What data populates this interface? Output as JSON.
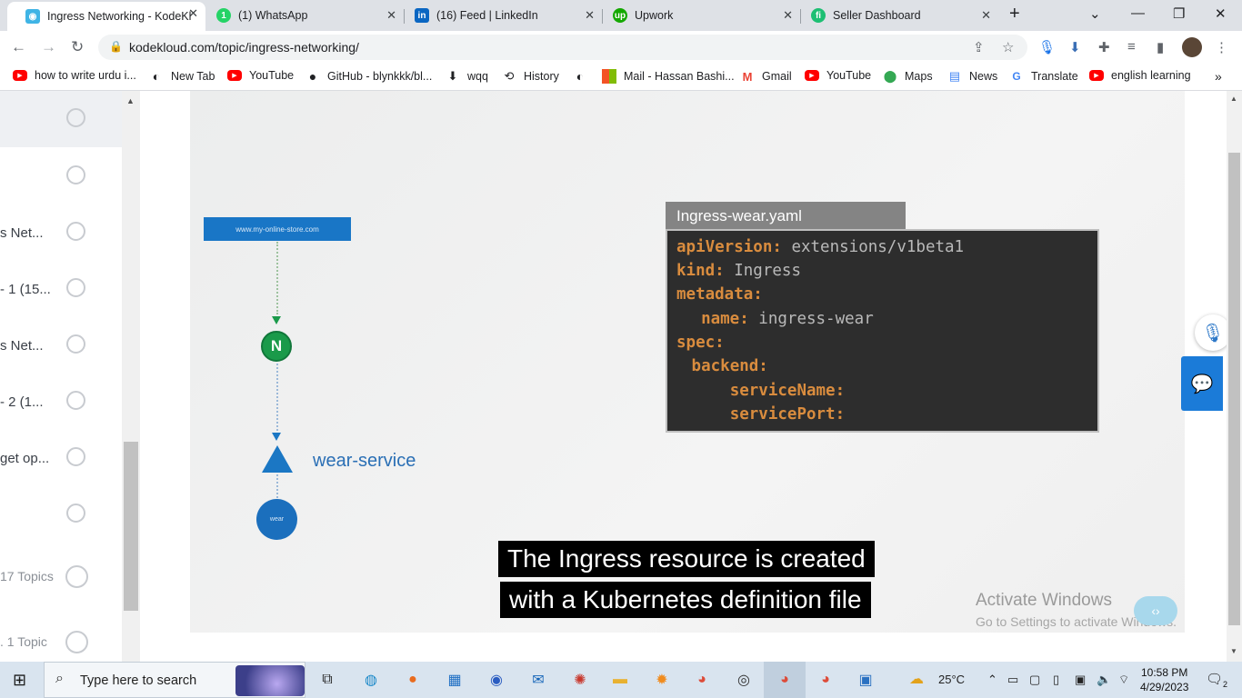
{
  "browser": {
    "tabs": [
      {
        "title": "Ingress Networking - KodeKl",
        "icon_color": "#3fb4e5",
        "icon_glyph": "◉"
      },
      {
        "title": "(1) WhatsApp",
        "icon_color": "#25d366",
        "icon_glyph": "1"
      },
      {
        "title": "(16) Feed | LinkedIn",
        "icon_color": "#0a66c2",
        "icon_glyph": "in"
      },
      {
        "title": "Upwork",
        "icon_color": "#14a800",
        "icon_glyph": "up"
      },
      {
        "title": "Seller Dashboard",
        "icon_color": "#1dbf73",
        "icon_glyph": "fi"
      }
    ],
    "new_tab": "+",
    "url": "kodekloud.com/topic/ingress-networking/",
    "bookmarks": [
      {
        "label": "how to write urdu i...",
        "icon": "youtube-icon"
      },
      {
        "label": "New Tab",
        "icon": "globe-icon"
      },
      {
        "label": "YouTube",
        "icon": "youtube-icon"
      },
      {
        "label": "GitHub - blynkkk/bl...",
        "icon": "github-icon"
      },
      {
        "label": "wqq",
        "icon": "download-icon"
      },
      {
        "label": "History",
        "icon": "history-icon"
      },
      {
        "label": "",
        "icon": "globe-icon"
      },
      {
        "label": "Mail - Hassan Bashi...",
        "icon": "microsoft-icon"
      },
      {
        "label": "Gmail",
        "icon": "gmail-icon"
      },
      {
        "label": "YouTube",
        "icon": "youtube-icon"
      },
      {
        "label": "Maps",
        "icon": "maps-icon"
      },
      {
        "label": "News",
        "icon": "news-icon"
      },
      {
        "label": "Translate",
        "icon": "translate-icon"
      },
      {
        "label": "english learning",
        "icon": "youtube-icon"
      }
    ]
  },
  "sidebar": {
    "items": [
      {
        "label": ""
      },
      {
        "label": ""
      },
      {
        "label": "s Net..."
      },
      {
        "label": "- 1 (15..."
      },
      {
        "label": "s Net..."
      },
      {
        "label": "- 2 (1..."
      },
      {
        "label": "get op..."
      },
      {
        "label": ""
      },
      {
        "label": "17 Topics"
      },
      {
        "label": ".  1 Topic"
      }
    ]
  },
  "video": {
    "host_label": "www.my-online-store.com",
    "nginx_letter": "N",
    "service_label": "wear-service",
    "pod_label": "wear",
    "yaml_filename": "Ingress-wear.yaml",
    "yaml_lines": [
      {
        "key": "apiVersion:",
        "value": " extensions/v1beta1",
        "indent": ""
      },
      {
        "key": "kind:",
        "value": " Ingress",
        "indent": ""
      },
      {
        "key": "metadata:",
        "value": "",
        "indent": ""
      },
      {
        "key": "name:",
        "value": " ingress-wear",
        "indent": "  "
      },
      {
        "key": "spec:",
        "value": "",
        "indent": ""
      },
      {
        "key": "backend:",
        "value": "",
        "indent": " "
      },
      {
        "key": "serviceName:",
        "value": "",
        "indent": "     "
      },
      {
        "key": "servicePort:",
        "value": "",
        "indent": "     "
      }
    ],
    "caption_line1": "The Ingress resource is created",
    "caption_line2": "with a Kubernetes definition file"
  },
  "watermark": {
    "line1": "Activate Windows",
    "line2": "Go to Settings to activate Windows."
  },
  "taskbar": {
    "search_placeholder": "Type here to search",
    "weather": "25°C",
    "time": "10:58 PM",
    "date": "4/29/2023",
    "notification_count": "2"
  }
}
